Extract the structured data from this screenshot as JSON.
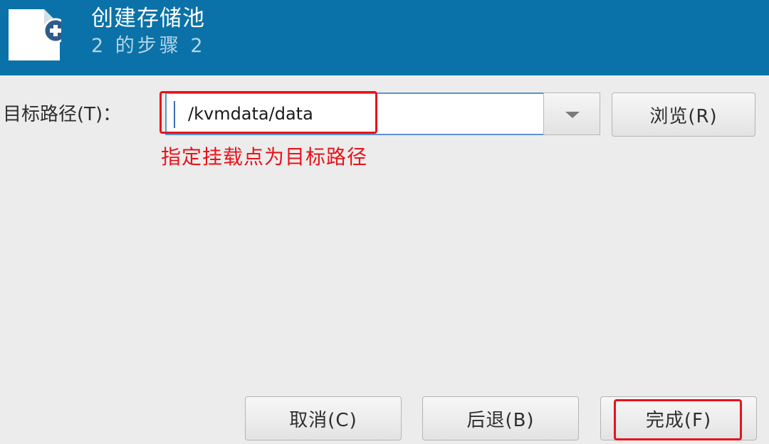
{
  "header": {
    "title": "创建存储池",
    "step": "2 的步骤 2",
    "icon": "new-document-add-icon",
    "background_color": "#0a72a8"
  },
  "target_path": {
    "label": "目标路径(T)：",
    "value": "/kvmdata/data",
    "dropdown_icon": "chevron-down-icon",
    "browse_label": "浏览(R)"
  },
  "annotation": {
    "text": "指定挂载点为目标路径",
    "color": "#e8131a"
  },
  "footer": {
    "cancel_label": "取消(C)",
    "back_label": "后退(B)",
    "finish_label": "完成(F)"
  }
}
